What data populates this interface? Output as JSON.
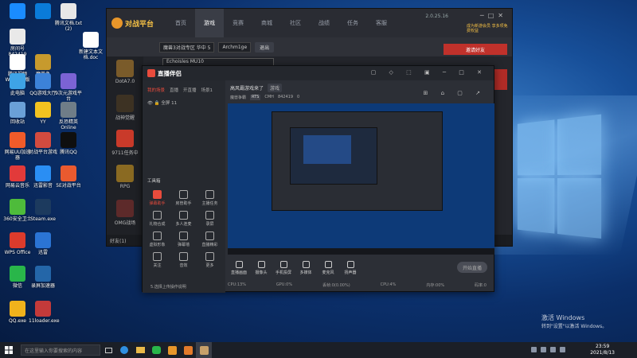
{
  "desktop": {
    "icons": [
      {
        "label": "",
        "color": "#1a8cff"
      },
      {
        "label": "",
        "color": "#0a7bd9"
      },
      {
        "label": "腾讯文档.txt (2)",
        "color": "#e7e7e7"
      },
      {
        "label": "房间号 842419",
        "color": "#e9e9e9"
      },
      {
        "label": "腾讯视频Win10专版",
        "color": "#ffffff"
      },
      {
        "label": "魔兽争霸.exe",
        "color": "#c79a2d"
      },
      {
        "label": "新建文本文档.doc",
        "color": "#ffffff"
      },
      {
        "label": "此电脑",
        "color": "#3ea3e6"
      },
      {
        "label": "QQ游戏大厅",
        "color": "#3c82d8"
      },
      {
        "label": "9次元游戏平台",
        "color": "#7b63d4"
      },
      {
        "label": "回收站",
        "color": "#6aa0d8"
      },
      {
        "label": "YY",
        "color": "#f2c220"
      },
      {
        "label": "反恐精英 Online",
        "color": "#6f7d88"
      },
      {
        "label": "网易UU加速器",
        "color": "#f05b2a"
      },
      {
        "label": "对战平台游戏",
        "color": "#d34b3f"
      },
      {
        "label": "腾讯QQ",
        "color": "#0f0f0f"
      },
      {
        "label": "网易云音乐",
        "color": "#e23a3a"
      },
      {
        "label": "迅雷影音",
        "color": "#2a8ef3"
      },
      {
        "label": "5E对战平台",
        "color": "#ea5a2f"
      },
      {
        "label": "360安全卫士",
        "color": "#4ebb3b"
      },
      {
        "label": "Steam.exe",
        "color": "#1c3a5e"
      },
      {
        "label": "WPS Office",
        "color": "#dc3b2c"
      },
      {
        "label": "迅雷",
        "color": "#2b74d4"
      },
      {
        "label": "微信",
        "color": "#29b64a"
      },
      {
        "label": "录屏加速器",
        "color": "#2466a8"
      },
      {
        "label": "QQ.exe",
        "color": "#f0b21c"
      },
      {
        "label": "11loader.exe",
        "color": "#c43a3a"
      }
    ],
    "watermark": {
      "title": "激活 Windows",
      "subtitle": "转到\"设置\"以激活 Windows。"
    }
  },
  "taskbar": {
    "search_placeholder": "在这里输入你要搜索的内容",
    "time": "23:59",
    "date": "2021/8/13"
  },
  "game_platform": {
    "logo": "对战平台",
    "version": "2.0.25.16",
    "nav": [
      "首页",
      "游戏",
      "竞赛",
      "商城",
      "社区",
      "战绩",
      "任务",
      "客服"
    ],
    "active_nav": "游戏",
    "badge": "成为新游会员 享多项免费权益",
    "room_field": "魔兽3对战专区 华中 5",
    "user_field": "Archm1ge",
    "quick_btn": "退出",
    "dropdown": "Echoisles MU10",
    "invite_btn": "邀请好友",
    "join_btn": "创建/加入",
    "sidebar": [
      {
        "label": "DotA7.0",
        "color": "#7a5b2a"
      },
      {
        "label": "战神觉醒",
        "color": "#3d3223"
      },
      {
        "label": "9711任务中",
        "color": "#c93a2a"
      },
      {
        "label": "RPG",
        "color": "#8a6a22"
      },
      {
        "label": "OMG战场",
        "color": "#5d2a2a"
      }
    ],
    "footer": "好友(1)"
  },
  "streamer": {
    "app_name": "直播伴侣",
    "tabs": [
      "我的场景",
      "直播",
      "开直播",
      "场景1"
    ],
    "active_tab": "我的场景",
    "scene_label": "全屏 11",
    "tools_header": "工具箱",
    "tools": [
      {
        "label": "弹幕助手",
        "hot": true
      },
      {
        "label": "房管助手",
        "hot": false
      },
      {
        "label": "主播任务",
        "hot": false
      },
      {
        "label": "礼物合成",
        "hot": false
      },
      {
        "label": "多人连麦",
        "hot": false
      },
      {
        "label": "录屏",
        "hot": false
      },
      {
        "label": "虚拟形象",
        "hot": false
      },
      {
        "label": "弹幕墙",
        "hot": false
      },
      {
        "label": "直播精彩",
        "hot": false
      },
      {
        "label": "关注",
        "hot": false
      },
      {
        "label": "音效",
        "hot": false
      },
      {
        "label": "更多",
        "hot": false
      }
    ],
    "foot_text": "5.选择上传操作说明",
    "room_title": "高风霸游戏来了",
    "room_tag": "游戏",
    "sub_items": [
      "魔兽争霸",
      "RTS",
      "CMH",
      "842419",
      "0"
    ],
    "controls": [
      "直播画面",
      "摄像头",
      "手机投屏",
      "多媒体",
      "麦克风",
      "扬声器"
    ],
    "live_btn": "开始直播",
    "status": [
      "CPU:13%",
      "GPU:0%",
      "丢帧:0(0.00%)",
      "CPU:4%",
      "内存:00%",
      "码率:0"
    ]
  }
}
